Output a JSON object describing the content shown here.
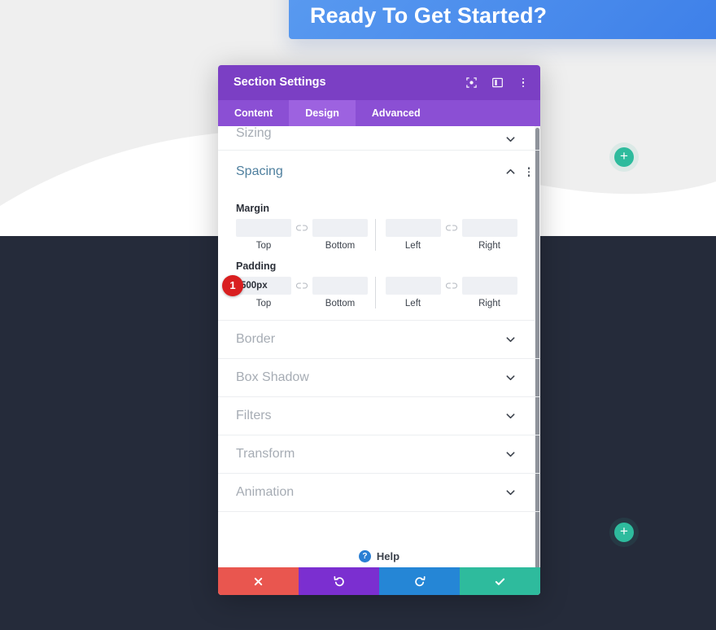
{
  "page": {
    "cta_banner_title": "Ready To Get Started?",
    "add_button_label": "+",
    "colors": {
      "banner_start": "#5a9bf0",
      "banner_end": "#3b7de8",
      "dark_section": "#252b3a",
      "page_background": "#efefef",
      "add_button": "#2ebb9d"
    }
  },
  "modal": {
    "title": "Section Settings",
    "header_icons": [
      {
        "name": "focus-target-icon"
      },
      {
        "name": "layout-columns-icon"
      },
      {
        "name": "more-vertical-icon"
      }
    ],
    "tabs": [
      {
        "label": "Content",
        "active": false
      },
      {
        "label": "Design",
        "active": true
      },
      {
        "label": "Advanced",
        "active": false
      }
    ],
    "sections": {
      "sizing": {
        "title": "Sizing",
        "state": "collapsed"
      },
      "spacing": {
        "title": "Spacing",
        "state": "expanded",
        "margin": {
          "label": "Margin",
          "fields": [
            {
              "sub_label": "Top",
              "value": "",
              "placeholder": ""
            },
            {
              "sub_label": "Bottom",
              "value": "",
              "placeholder": ""
            },
            {
              "sub_label": "Left",
              "value": "",
              "placeholder": ""
            },
            {
              "sub_label": "Right",
              "value": "",
              "placeholder": ""
            }
          ]
        },
        "padding": {
          "label": "Padding",
          "fields": [
            {
              "sub_label": "Top",
              "value": "500px",
              "placeholder": ""
            },
            {
              "sub_label": "Bottom",
              "value": "",
              "placeholder": ""
            },
            {
              "sub_label": "Left",
              "value": "",
              "placeholder": ""
            },
            {
              "sub_label": "Right",
              "value": "",
              "placeholder": ""
            }
          ]
        }
      },
      "collapsed_list": [
        {
          "title": "Border"
        },
        {
          "title": "Box Shadow"
        },
        {
          "title": "Filters"
        },
        {
          "title": "Transform"
        },
        {
          "title": "Animation"
        }
      ]
    },
    "help": {
      "icon_label": "?",
      "label": "Help"
    },
    "footer_buttons": [
      {
        "name": "cancel-button",
        "icon": "close-icon",
        "color": "#e9564f"
      },
      {
        "name": "undo-button",
        "icon": "undo-icon",
        "color": "#7b2fd0"
      },
      {
        "name": "redo-button",
        "icon": "redo-icon",
        "color": "#2586d6"
      },
      {
        "name": "save-button",
        "icon": "check-icon",
        "color": "#2ebb9d"
      }
    ]
  },
  "annotations": {
    "step_one": "1"
  }
}
